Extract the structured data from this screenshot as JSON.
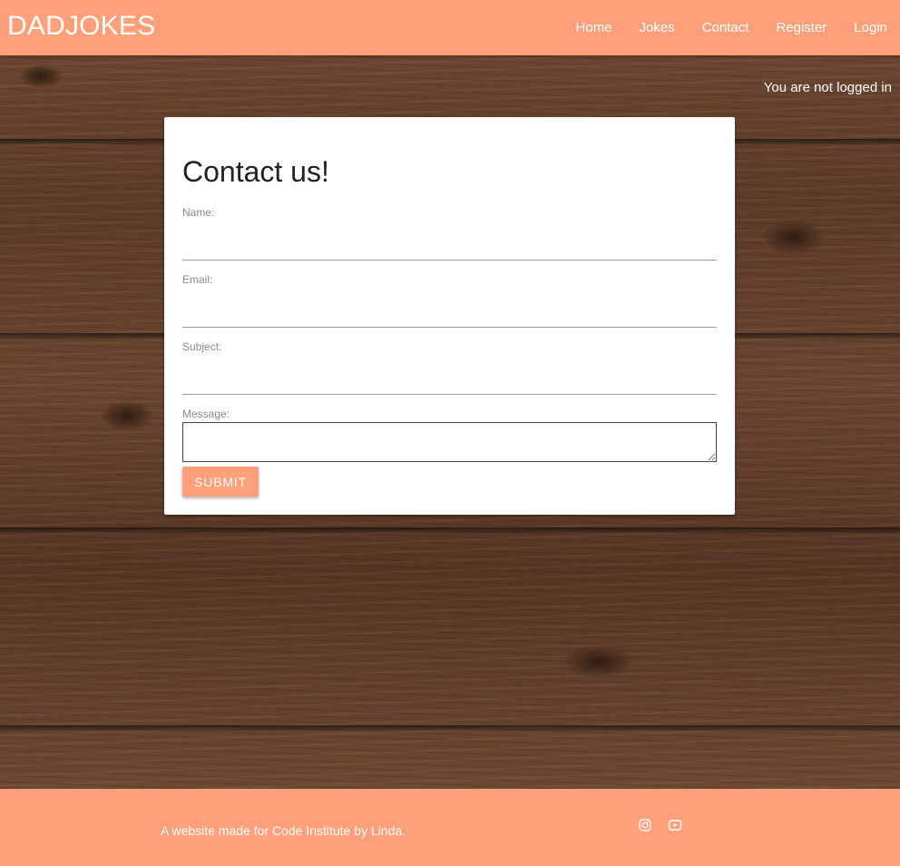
{
  "header": {
    "brand": "DADJOKES",
    "nav": [
      {
        "label": "Home"
      },
      {
        "label": "Jokes"
      },
      {
        "label": "Contact"
      },
      {
        "label": "Register"
      },
      {
        "label": "Login"
      }
    ]
  },
  "status": {
    "login_text": "You are not logged in"
  },
  "contact_form": {
    "title": "Contact us!",
    "fields": {
      "name": {
        "label": "Name:",
        "value": ""
      },
      "email": {
        "label": "Email:",
        "value": ""
      },
      "subject": {
        "label": "Subject:",
        "value": ""
      },
      "message": {
        "label": "Message:",
        "value": ""
      }
    },
    "submit_label": "SUBMIT"
  },
  "footer": {
    "text": "A website made for Code Institute by Linda.",
    "social_icons": [
      "instagram-icon",
      "youtube-icon"
    ]
  },
  "colors": {
    "accent": "#ffa07a",
    "card": "#ffffff",
    "label_text": "#8a8a8a"
  }
}
